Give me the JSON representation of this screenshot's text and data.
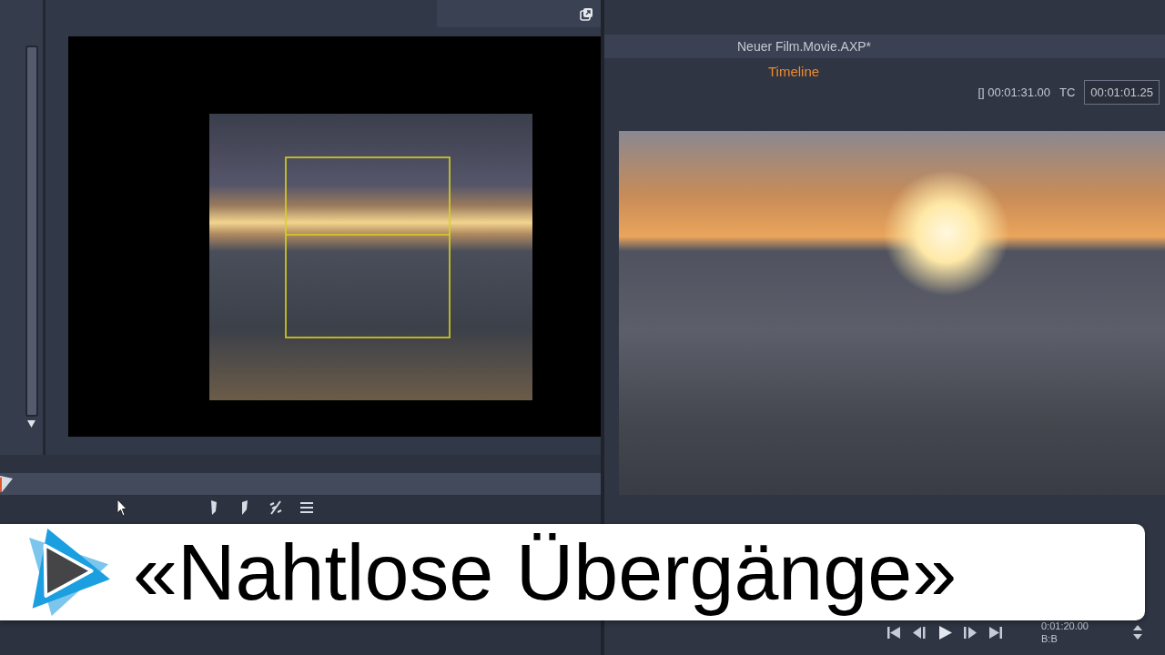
{
  "player_header": {
    "project_title": "Neuer Film.Movie.AXP*",
    "tab": {
      "label": "Timeline",
      "selected": true
    },
    "duration": "[] 00:01:31.00",
    "tc_label": "TC",
    "timecode": "00:01:01.25"
  },
  "player_controls": {
    "ruler_time": "0:01:20.00",
    "extra": "B:B"
  },
  "title_banner": {
    "text": "«Nahtlose Übergänge»"
  }
}
